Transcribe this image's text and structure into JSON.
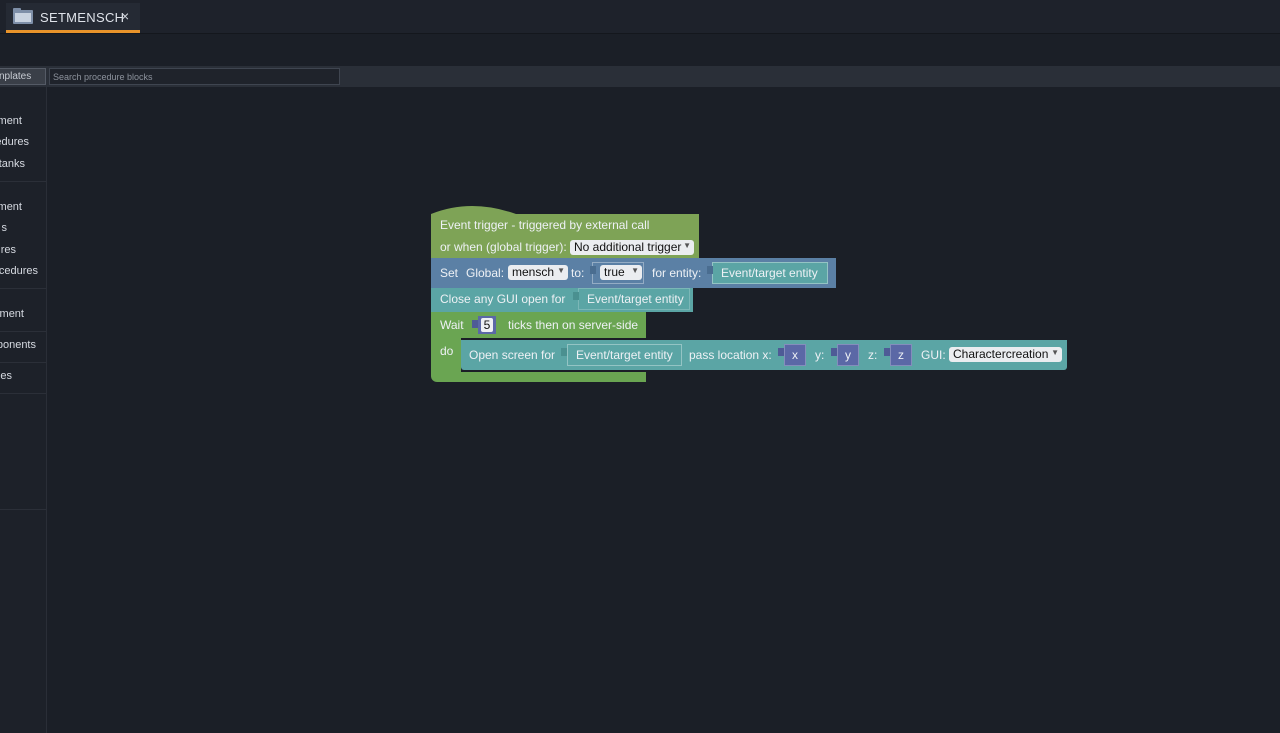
{
  "tab": {
    "title": "SETMENSCH",
    "close": "×",
    "icon": "folder-icon"
  },
  "toolbar": {
    "templates_label": "nplates",
    "search_placeholder": "Search procedure blocks"
  },
  "sidebar": {
    "items": [
      {
        "label": "ment"
      },
      {
        "label": "edures"
      },
      {
        "label": "tanks"
      },
      {
        "label": "ment"
      },
      {
        "label": "s"
      },
      {
        "label": "res"
      },
      {
        "label": "cedures"
      },
      {
        "label": "ment"
      },
      {
        "label": "ponents"
      },
      {
        "label": "es"
      }
    ]
  },
  "blocks": {
    "trigger": {
      "line1": "Event trigger - triggered by external call",
      "line2": "or when (global trigger):",
      "dropdown": "No additional trigger",
      "color": "#7ea356"
    },
    "set_global": {
      "set": "Set",
      "global": "Global:",
      "var": "mensch",
      "to": "to:",
      "value": "true",
      "for_entity": "for entity:",
      "entity": "Event/target entity",
      "color": "#5b80a5"
    },
    "close_gui": {
      "label": "Close any GUI open for",
      "entity": "Event/target entity",
      "color": "#5ba5a5"
    },
    "wait": {
      "wait": "Wait",
      "ticks": "5",
      "then": "ticks then on server-side",
      "do": "do",
      "color": "#6aa552"
    },
    "open_screen": {
      "label": "Open screen for",
      "entity": "Event/target entity",
      "pass": "pass location x:",
      "x": "x",
      "y_label": "y:",
      "y": "y",
      "z_label": "z:",
      "z": "z",
      "gui_label": "GUI:",
      "gui": "Charactercreation",
      "color": "#5ba5a5"
    }
  }
}
